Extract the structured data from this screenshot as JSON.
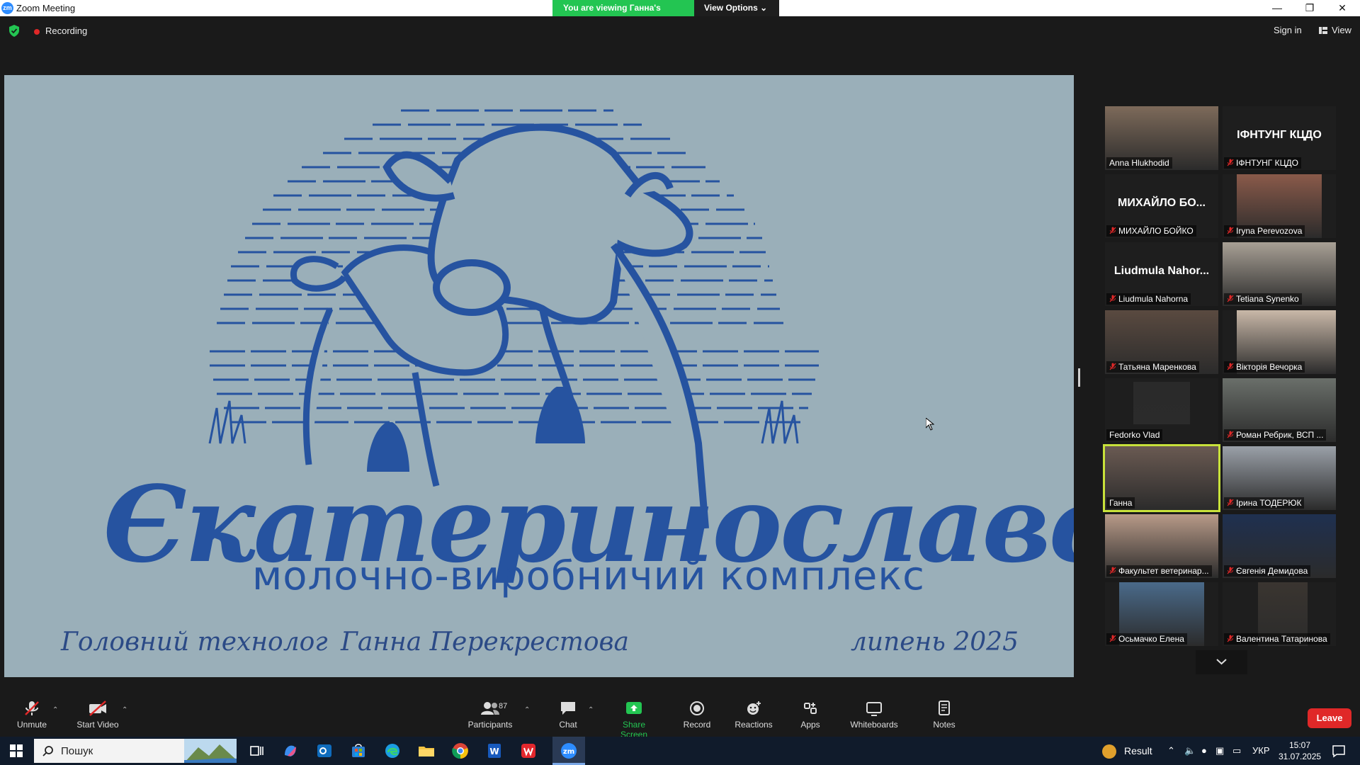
{
  "window": {
    "title": "Zoom Meeting",
    "banner_text": "You are viewing Ганна's screen",
    "view_options_label": "View Options"
  },
  "topbar": {
    "recording_label": "Recording",
    "sign_in_label": "Sign in",
    "view_label": "View"
  },
  "slide": {
    "brand": "Єкатеринославський",
    "subtitle": "молочно-виробничий комплекс",
    "role": "Головний технолог",
    "presenter": "Ганна Перекрестова",
    "date": "липень    2025"
  },
  "gallery": {
    "tiles": [
      {
        "name": "Anna Hlukhodid",
        "big": "",
        "muted": false
      },
      {
        "name": "ІФНТУНГ КЦДО",
        "big": "ІФНТУНГ КЦДО",
        "muted": true
      },
      {
        "name": "МИХАЙЛО БОЙКО",
        "big": "МИХАЙЛО БО...",
        "muted": true
      },
      {
        "name": "Iryna Perevozova",
        "big": "",
        "muted": true
      },
      {
        "name": "Liudmula Nahorna",
        "big": "Liudmula Nahor...",
        "muted": true
      },
      {
        "name": "Tetiana Synenko",
        "big": "",
        "muted": true
      },
      {
        "name": "Татьяна Маренкова",
        "big": "",
        "muted": true
      },
      {
        "name": "Вікторія Вечорка",
        "big": "",
        "muted": true
      },
      {
        "name": "Fedorko Vlad",
        "big": "",
        "muted": false
      },
      {
        "name": "Роман Ребрик, ВСП ...",
        "big": "",
        "muted": true
      },
      {
        "name": "Ганна",
        "big": "",
        "muted": false
      },
      {
        "name": "Ірина ТОДЕРЮК",
        "big": "",
        "muted": true
      },
      {
        "name": "Факультет ветеринар...",
        "big": "",
        "muted": true
      },
      {
        "name": "Євгенія Демидова",
        "big": "",
        "muted": true
      },
      {
        "name": "Осьмачко Елена",
        "big": "",
        "muted": true
      },
      {
        "name": "Валентина Татаринова",
        "big": "",
        "muted": true
      }
    ]
  },
  "toolbar": {
    "unmute": "Unmute",
    "start_video": "Start Video",
    "participants": "Participants",
    "participants_count": "87",
    "chat": "Chat",
    "share_screen": "Share Screen",
    "record": "Record",
    "reactions": "Reactions",
    "apps": "Apps",
    "whiteboards": "Whiteboards",
    "notes": "Notes",
    "leave": "Leave"
  },
  "taskbar": {
    "search_placeholder": "Пошук",
    "weather": "Result",
    "language": "УКР",
    "time": "15:07",
    "date": "31.07.2025"
  },
  "colors": {
    "zoom_blue": "#2d8cff",
    "banner_green": "#23c552",
    "leave_red": "#e02828",
    "slide_bg": "#9aafb9",
    "brand_blue": "#2653a0",
    "active_speaker": "#c8e23a"
  }
}
